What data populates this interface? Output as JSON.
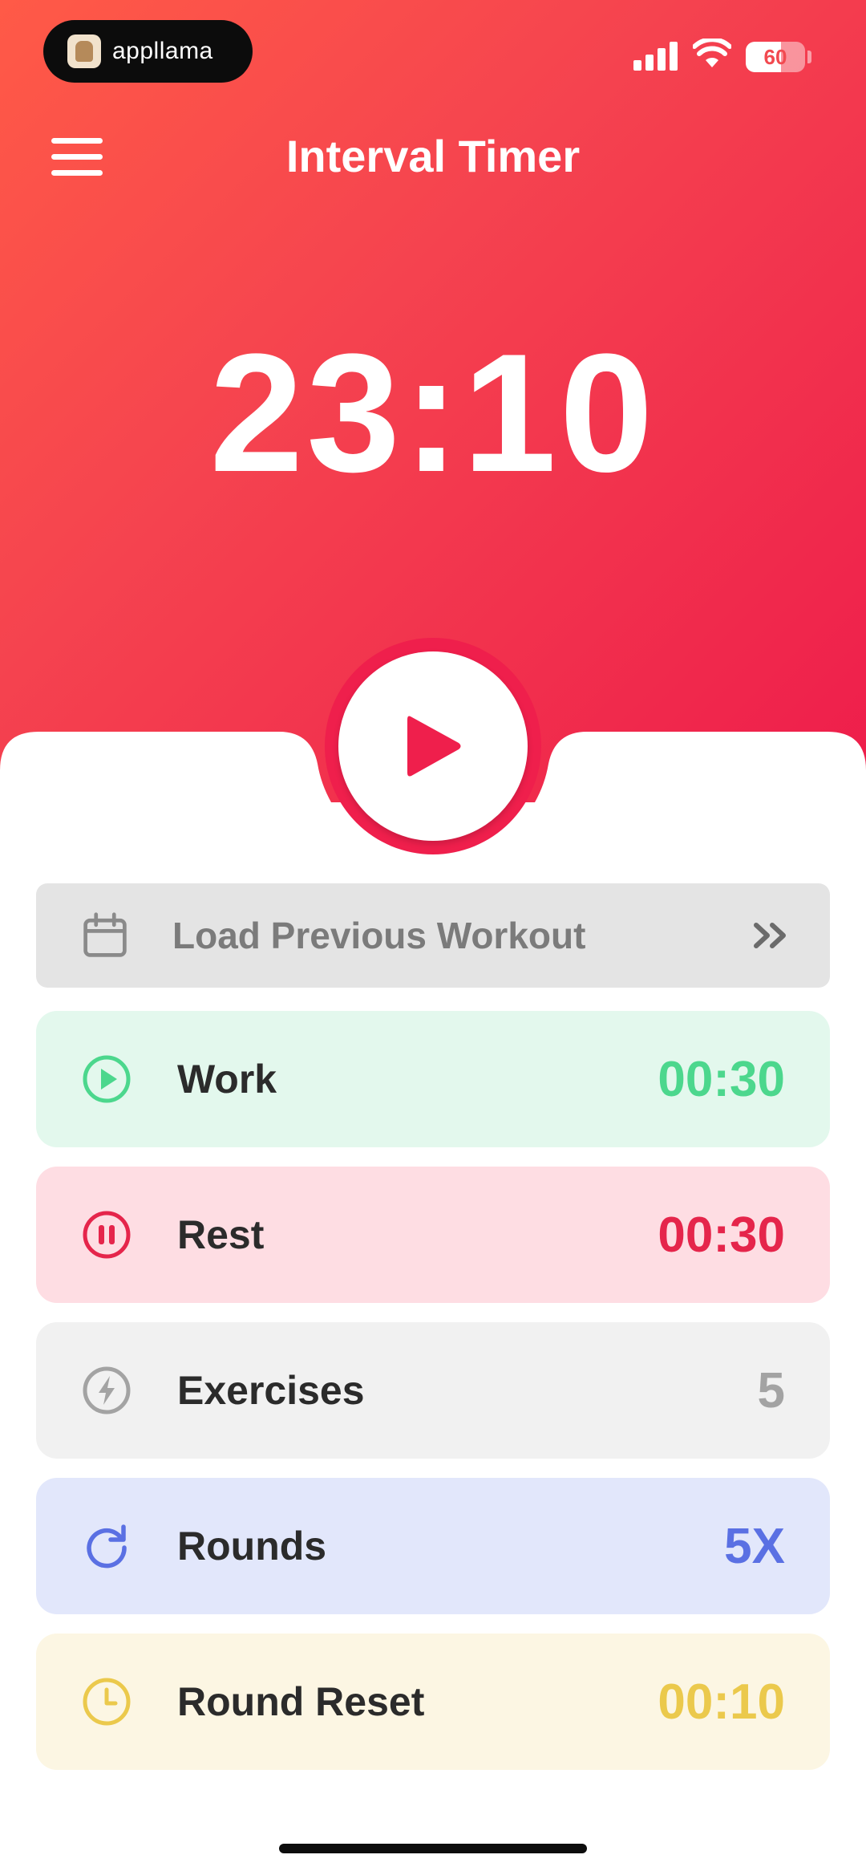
{
  "status_bar": {
    "brand": "appllama",
    "battery": "60",
    "battery_level": 0.6
  },
  "header": {
    "title": "Interval Timer",
    "menu_icon": "hamburger-menu-icon"
  },
  "timer": {
    "display": "23:10"
  },
  "play_button": {
    "icon": "play-icon"
  },
  "load_previous": {
    "label": "Load Previous Workout",
    "icon": "calendar-icon",
    "action_icon": "double-chevron-right-icon"
  },
  "settings": [
    {
      "key": "work",
      "label": "Work",
      "value": "00:30",
      "icon": "play-circle-icon",
      "color": "#4cd78d",
      "bg": "#e3f8ed"
    },
    {
      "key": "rest",
      "label": "Rest",
      "value": "00:30",
      "icon": "pause-circle-icon",
      "color": "#e5254b",
      "bg": "#fedde3"
    },
    {
      "key": "exercises",
      "label": "Exercises",
      "value": "5",
      "icon": "lightning-circle-icon",
      "color": "#a3a3a3",
      "bg": "#f1f1f1"
    },
    {
      "key": "rounds",
      "label": "Rounds",
      "value": "5X",
      "icon": "refresh-icon",
      "color": "#5a70e3",
      "bg": "#e2e7fb"
    },
    {
      "key": "round_reset",
      "label": "Round Reset",
      "value": "00:10",
      "icon": "clock-icon",
      "color": "#ebc94c",
      "bg": "#fcf6e3"
    }
  ],
  "colors": {
    "accent": "#ef1f4c",
    "hero_gradient_start": "#ff5a47",
    "hero_gradient_end": "#ee1d4b"
  }
}
